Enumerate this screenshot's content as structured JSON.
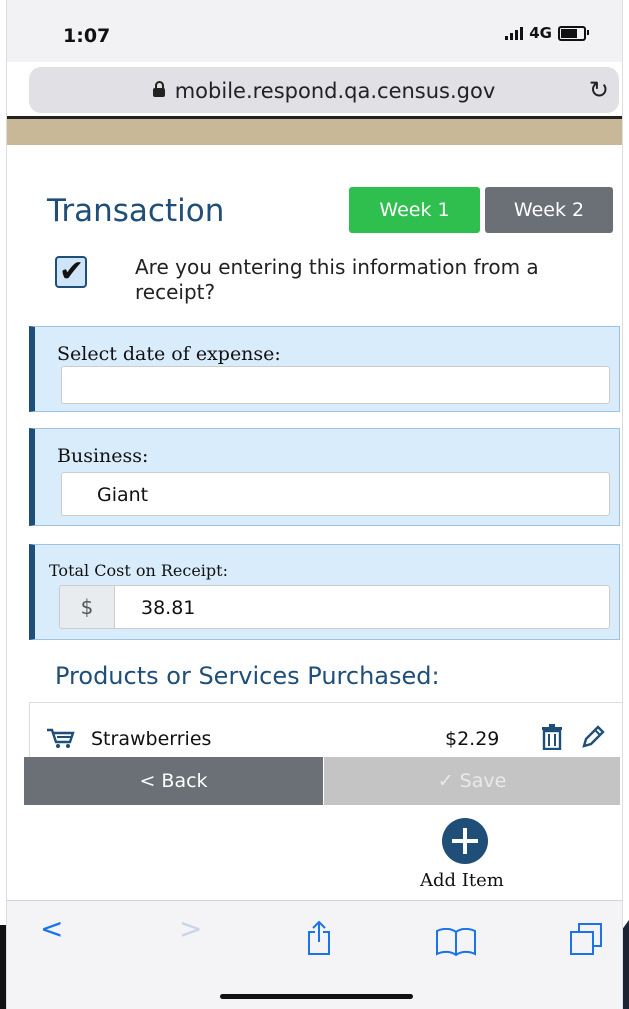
{
  "status_bar": {
    "time": "1:07",
    "network": "4G"
  },
  "browser": {
    "url": "mobile.respond.qa.census.gov"
  },
  "header": {
    "title": "Transaction",
    "tabs": [
      {
        "label": "Week 1",
        "active": true
      },
      {
        "label": "Week 2",
        "active": false
      }
    ]
  },
  "receipt_checkbox": {
    "label": "Are you entering this information from a receipt?",
    "checked": true
  },
  "date_field": {
    "label": "Select date of expense:",
    "value": ""
  },
  "business_field": {
    "label": "Business:",
    "value": "Giant"
  },
  "total_cost": {
    "label": "Total Cost on Receipt:",
    "currency_symbol": "$",
    "value": "38.81"
  },
  "products": {
    "heading": "Products or Services Purchased:",
    "items": [
      {
        "name": "Strawberries",
        "price": "$2.29"
      }
    ]
  },
  "actions": {
    "back_label": "< Back",
    "save_label": "✓ Save",
    "add_item_label": "Add Item"
  },
  "colors": {
    "primary": "#1f4e79",
    "active_tab": "#2ebf4f",
    "inactive_tab": "#6b7077",
    "card_bg": "#d9ecfb",
    "safari_blue": "#1a73e8"
  }
}
